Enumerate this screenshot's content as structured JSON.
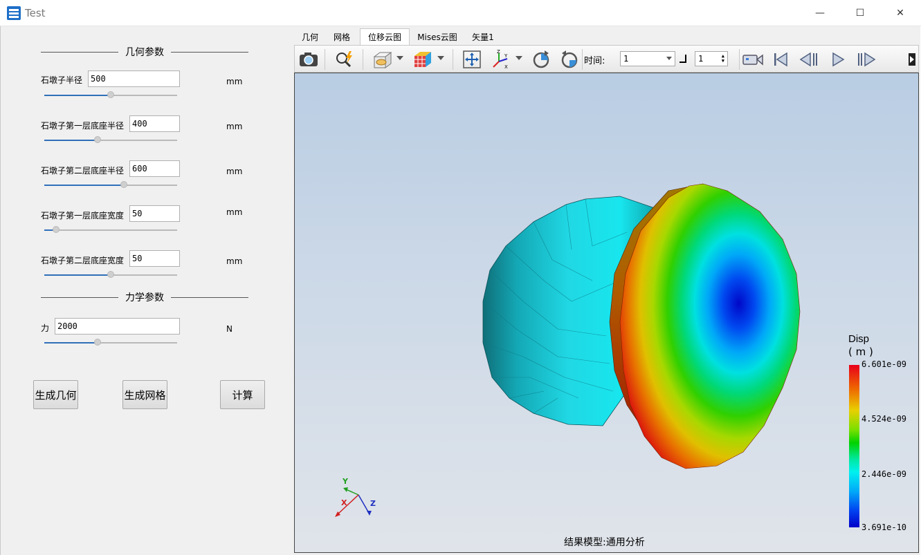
{
  "window": {
    "title": "Test",
    "minimize_glyph": "—",
    "maximize_glyph": "☐",
    "close_glyph": "✕"
  },
  "left_panel": {
    "geometry_group_title": "几何参数",
    "mechanics_group_title": "力学参数",
    "params": [
      {
        "label": "石墩子半径",
        "value": "500",
        "unit": "mm",
        "slider_fraction": 0.5
      },
      {
        "label": "石墩子第一层底座半径",
        "value": "400",
        "unit": "mm",
        "slider_fraction": 0.4
      },
      {
        "label": "石墩子第二层底座半径",
        "value": "600",
        "unit": "mm",
        "slider_fraction": 0.6
      },
      {
        "label": "石墩子第一层底座宽度",
        "value": "50",
        "unit": "mm",
        "slider_fraction": 0.09
      },
      {
        "label": "石墩子第二层底座宽度",
        "value": "50",
        "unit": "mm",
        "slider_fraction": 0.5
      }
    ],
    "force": {
      "label": "力",
      "value": "2000",
      "unit": "N",
      "slider_fraction": 0.4
    },
    "buttons": {
      "generate_geometry": "生成几何",
      "generate_mesh": "生成网格",
      "compute": "计算"
    }
  },
  "tabs": [
    {
      "label": "几何",
      "active": false
    },
    {
      "label": "网格",
      "active": false
    },
    {
      "label": "位移云图",
      "active": true
    },
    {
      "label": "Mises云图",
      "active": false
    },
    {
      "label": "矢量1",
      "active": false
    }
  ],
  "toolbar": {
    "time_label": "时间:",
    "time_value": "1",
    "step_value": "1",
    "icons": [
      "camera-icon",
      "zoom-lightning-icon",
      "box-view-icon",
      "cube-color-icon",
      "fit-move-icon",
      "axes-icon",
      "rotate-cw-icon",
      "rotate-ccw-icon",
      "video-camera-icon",
      "first-frame-icon",
      "prev-frame-icon",
      "play-icon",
      "next-frame-icon"
    ]
  },
  "viewport": {
    "status": "结果模型:通用分析",
    "legend": {
      "title": "Disp",
      "unit": "( m )",
      "max": "6.601e-09",
      "mid_high": "4.524e-09",
      "mid_low": "2.446e-09",
      "min": "3.691e-10"
    },
    "axes": {
      "x": "X",
      "y": "Y",
      "z": "Z"
    }
  },
  "colors": {
    "accent": "#2f6fb8",
    "panel_bg": "#f0f0f0",
    "base_cylinder": "#1ec8d0"
  }
}
